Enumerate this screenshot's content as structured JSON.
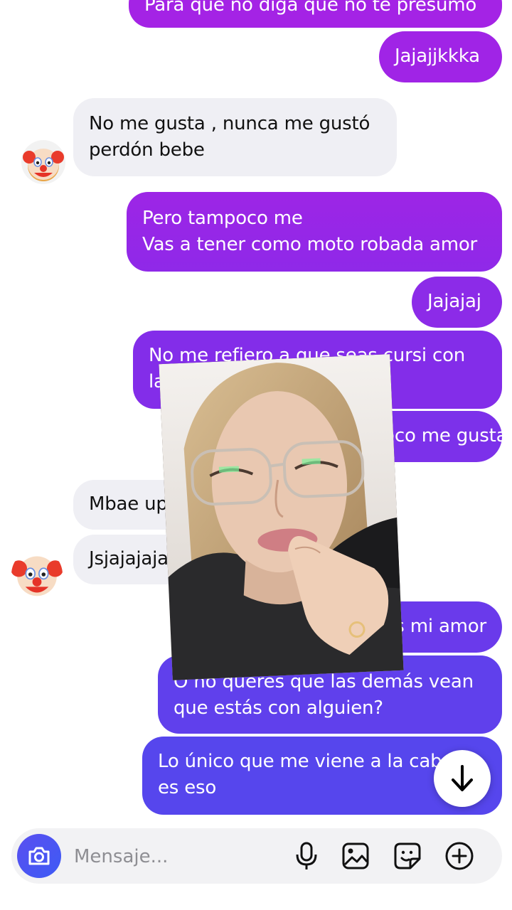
{
  "messages": [
    {
      "lines": [
        "Para que no diga que no te presumo"
      ]
    },
    {
      "lines": [
        "Jajajjkkka"
      ]
    },
    {
      "lines": [
        "No me gusta , nunca me gustó",
        "perdón bebe"
      ]
    },
    {
      "lines": [
        "Pero tampoco me",
        "Vas a tener como moto robada amor"
      ]
    },
    {
      "lines": [
        "Jajajaj"
      ]
    },
    {
      "lines": [
        "No me refiero a que seas cursi con",
        "las publicaciones"
      ]
    },
    {
      "lines": [
        "tampoco me gusta"
      ]
    },
    {
      "lines": [
        "Mbae upe"
      ]
    },
    {
      "lines": [
        "Jsjajajajajai"
      ]
    },
    {
      "lines": [
        "es mi amor"
      ]
    },
    {
      "lines": [
        "O no queres que las demás vean",
        "que estás con alguien?"
      ]
    },
    {
      "lines": [
        "Lo único que me viene a la cabeza",
        "es eso"
      ]
    }
  ],
  "composer": {
    "placeholder": "Mensaje..."
  },
  "icons": {
    "camera": "camera-icon",
    "mic": "microphone-icon",
    "gallery": "gallery-icon",
    "sticker": "sticker-icon",
    "more": "plus-icon",
    "scroll": "arrow-down-icon",
    "avatar": "clown-face-emoji"
  },
  "colors": {
    "sent_top": "#a124e6",
    "sent_bottom": "#5a45ec",
    "received": "#efeff4",
    "accent": "#4f55f1"
  }
}
